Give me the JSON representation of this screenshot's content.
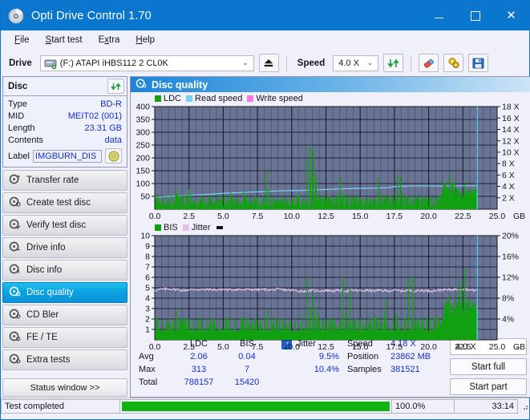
{
  "window": {
    "title": "Opti Drive Control 1.70",
    "icon": "disc-icon",
    "controls": {
      "minimize": "minimize-icon",
      "maximize": "maximize-icon",
      "close": "close-icon"
    }
  },
  "menu": {
    "items": [
      {
        "label": "File",
        "accel": "F"
      },
      {
        "label": "Start test",
        "accel": "S"
      },
      {
        "label": "Extra",
        "accel": "x"
      },
      {
        "label": "Help",
        "accel": "H"
      }
    ]
  },
  "toolbar": {
    "drive_label": "Drive",
    "drive_value": "(F:)  ATAPI iHBS112  2 CL0K",
    "eject_icon": "eject-icon",
    "speed_label": "Speed",
    "speed_value": "4.0 X",
    "refresh_icon": "refresh-icon",
    "erase_icon": "eraser-icon",
    "settings_icon": "gears-icon",
    "save_icon": "save-icon"
  },
  "disc": {
    "title": "Disc",
    "refresh_icon": "refresh-icon",
    "rows": [
      {
        "key": "Type",
        "value": "BD-R"
      },
      {
        "key": "MID",
        "value": "MEIT02 (001)"
      },
      {
        "key": "Length",
        "value": "23.31 GB"
      },
      {
        "key": "Contents",
        "value": "data"
      }
    ],
    "label_key": "Label",
    "label_value": "IMGBURN_DIS",
    "label_icon": "cd-icon"
  },
  "nav": {
    "items": [
      {
        "label": "Transfer rate",
        "icon": "disc-test-icon",
        "active": false
      },
      {
        "label": "Create test disc",
        "icon": "disc-test-icon",
        "active": false
      },
      {
        "label": "Verify test disc",
        "icon": "disc-test-icon",
        "active": false
      },
      {
        "label": "Drive info",
        "icon": "disc-test-icon",
        "active": false
      },
      {
        "label": "Disc info",
        "icon": "disc-test-icon",
        "active": false
      },
      {
        "label": "Disc quality",
        "icon": "disc-test-icon",
        "active": true
      },
      {
        "label": "CD Bler",
        "icon": "disc-test-icon",
        "active": false
      },
      {
        "label": "FE / TE",
        "icon": "disc-test-icon",
        "active": false
      },
      {
        "label": "Extra tests",
        "icon": "disc-test-icon",
        "active": false
      }
    ],
    "status_window": "Status window >>"
  },
  "main": {
    "title": "Disc quality",
    "icon": "disc-quality-icon"
  },
  "colors": {
    "ldc": "#11a111",
    "bis": "#11a111",
    "read_speed": "#79d2f2",
    "write_speed": "#f47ae0",
    "jitter": "#e3c0e8",
    "plot_bg": "#697495",
    "grid": "#151a28",
    "accent": "#1430c8",
    "cursor": "#5ec8f0",
    "progress": "#13b213"
  },
  "chart_data": [
    {
      "type": "line",
      "name": "ldc-chart",
      "title": "",
      "xlabel": "GB",
      "ylabel": "",
      "y2label": "X",
      "xlim": [
        0,
        25.0
      ],
      "ylim": [
        0,
        400
      ],
      "y2lim": [
        0,
        18
      ],
      "grid": true,
      "legend_position": "top-left",
      "legend": [
        {
          "label": "LDC",
          "color": "#11a111"
        },
        {
          "label": "Read speed",
          "color": "#79d2f2"
        },
        {
          "label": "Write speed",
          "color": "#f47ae0"
        }
      ],
      "xticks": [
        "0.0",
        "2.5",
        "5.0",
        "7.5",
        "10.0",
        "12.5",
        "15.0",
        "17.5",
        "20.0",
        "22.5",
        "25.0"
      ],
      "xtick_values": [
        0,
        2.5,
        5,
        7.5,
        10,
        12.5,
        15,
        17.5,
        20,
        22.5,
        25
      ],
      "yticks": [
        "50",
        "100",
        "150",
        "200",
        "250",
        "300",
        "350",
        "400"
      ],
      "ytick_values": [
        50,
        100,
        150,
        200,
        250,
        300,
        350,
        400
      ],
      "y2ticks": [
        "2 X",
        "4 X",
        "6 X",
        "8 X",
        "10 X",
        "12 X",
        "14 X",
        "16 X",
        "18 X"
      ],
      "y2tick_values": [
        2,
        4,
        6,
        8,
        10,
        12,
        14,
        16,
        18
      ],
      "data_end_gb": 23.55,
      "series": [
        {
          "name": "Read speed",
          "color": "#79d2f2",
          "axis": "y2",
          "x": [
            0.0,
            1.0,
            2.0,
            3.0,
            4.0,
            5.0,
            6.0,
            7.0,
            8.0,
            9.0,
            10.0,
            11.0,
            12.0,
            13.0,
            14.0,
            15.0,
            16.0,
            17.0,
            17.6,
            18.5,
            19.5,
            20.5,
            21.5,
            22.5,
            23.5
          ],
          "values": [
            2.1,
            2.25,
            2.35,
            2.5,
            2.6,
            2.8,
            2.9,
            3.0,
            3.1,
            3.2,
            3.25,
            3.3,
            3.4,
            3.5,
            3.6,
            3.65,
            3.7,
            3.75,
            4.0,
            4.05,
            4.1,
            4.05,
            4.05,
            4.1,
            4.1
          ]
        },
        {
          "name": "LDC",
          "color": "#11a111",
          "axis": "y1",
          "note": "dense per-sample spike histogram, baseline ~15-40, many spikes 60-250, rising density after 21 GB",
          "x": [
            0.1,
            0.3,
            0.5,
            0.7,
            0.9,
            1.1,
            1.3,
            1.5,
            1.6,
            1.7,
            1.9,
            2.1,
            2.3,
            2.45,
            2.5,
            2.7,
            2.9,
            3.1,
            3.3,
            3.5,
            3.7,
            3.9,
            4.1,
            4.3,
            4.5,
            4.7,
            4.9,
            5.05,
            5.1,
            5.3,
            5.5,
            5.6,
            5.7,
            5.9,
            6.1,
            6.3,
            6.45,
            6.5,
            6.7,
            6.9,
            7.1,
            7.3,
            7.5,
            7.7,
            7.9,
            8.1,
            8.3,
            8.45,
            8.5,
            8.7,
            8.9,
            9.1,
            9.3,
            9.5,
            9.7,
            9.9,
            10.1,
            10.3,
            10.5,
            10.7,
            10.9,
            11.1,
            11.3,
            11.35,
            11.5,
            11.55,
            11.7,
            11.75,
            11.9,
            12.1,
            12.3,
            12.5,
            12.7,
            12.9,
            13.1,
            13.3,
            13.5,
            13.7,
            13.9,
            14.1,
            14.3,
            14.5,
            14.7,
            14.9,
            15.1,
            15.3,
            15.5,
            15.7,
            15.9,
            16.1,
            16.3,
            16.5,
            16.7,
            16.9,
            17.1,
            17.3,
            17.5,
            17.6,
            17.7,
            17.9,
            18.1,
            18.3,
            18.5,
            18.7,
            18.9,
            19.0,
            19.1,
            19.3,
            19.5,
            19.7,
            19.9,
            20.1,
            20.3,
            20.5,
            20.7,
            20.9,
            21.1,
            21.3,
            21.5,
            21.7,
            21.9,
            22.1,
            22.3,
            22.5,
            22.7,
            22.9,
            23.1,
            23.3,
            23.5
          ],
          "values": [
            20,
            25,
            18,
            22,
            30,
            26,
            24,
            75,
            60,
            40,
            28,
            26,
            30,
            78,
            55,
            24,
            22,
            26,
            30,
            28,
            24,
            22,
            30,
            26,
            24,
            55,
            35,
            42,
            30,
            28,
            70,
            48,
            35,
            30,
            26,
            24,
            70,
            45,
            30,
            28,
            26,
            30,
            28,
            26,
            30,
            150,
            80,
            45,
            30,
            28,
            26,
            30,
            28,
            26,
            30,
            28,
            30,
            26,
            28,
            30,
            26,
            200,
            250,
            120,
            145,
            230,
            135,
            120,
            55,
            40,
            35,
            40,
            38,
            36,
            40,
            38,
            125,
            60,
            40,
            60,
            40,
            35,
            40,
            38,
            36,
            40,
            38,
            40,
            36,
            38,
            125,
            60,
            45,
            35,
            40,
            38,
            36,
            40,
            135,
            125,
            60,
            45,
            40,
            38,
            36,
            40,
            38,
            36,
            40,
            38,
            42,
            44,
            46,
            48,
            52,
            60,
            70,
            90,
            140,
            100,
            70,
            60,
            55,
            50,
            48
          ]
        }
      ],
      "cursor_gb": 23.55
    },
    {
      "type": "line",
      "name": "bis-chart",
      "title": "",
      "xlabel": "GB",
      "ylabel": "",
      "y2label": "%",
      "xlim": [
        0,
        25.0
      ],
      "ylim": [
        0,
        10
      ],
      "y2lim": [
        0,
        20
      ],
      "grid": true,
      "legend_position": "top-left",
      "legend": [
        {
          "label": "BIS",
          "color": "#11a111"
        },
        {
          "label": "Jitter",
          "color": "#e3c0e8"
        }
      ],
      "xticks": [
        "0.0",
        "2.5",
        "5.0",
        "7.5",
        "10.0",
        "12.5",
        "15.0",
        "17.5",
        "20.0",
        "22.5",
        "25.0"
      ],
      "xtick_values": [
        0,
        2.5,
        5,
        7.5,
        10,
        12.5,
        15,
        17.5,
        20,
        22.5,
        25
      ],
      "yticks": [
        "1",
        "2",
        "3",
        "4",
        "5",
        "6",
        "7",
        "8",
        "9",
        "10"
      ],
      "ytick_values": [
        1,
        2,
        3,
        4,
        5,
        6,
        7,
        8,
        9,
        10
      ],
      "y2ticks": [
        "4%",
        "8%",
        "12%",
        "16%",
        "20%"
      ],
      "y2tick_values": [
        4,
        8,
        12,
        16,
        20
      ],
      "data_end_gb": 23.55,
      "series": [
        {
          "name": "Jitter",
          "color": "#e3c0e8",
          "axis": "y2",
          "note": "noisy flat band around 9.4-9.7%",
          "x": [
            0.0,
            0.5,
            1.0,
            1.5,
            2.0,
            2.5,
            3.0,
            3.5,
            4.0,
            4.5,
            5.0,
            5.5,
            6.0,
            6.5,
            7.0,
            7.5,
            8.0,
            8.5,
            9.0,
            9.5,
            10.0,
            10.5,
            11.0,
            11.5,
            12.0,
            12.5,
            13.0,
            13.5,
            14.0,
            14.5,
            15.0,
            15.5,
            16.0,
            16.5,
            17.0,
            17.5,
            18.0,
            18.5,
            19.0,
            19.5,
            20.0,
            20.5,
            21.0,
            21.5,
            22.0,
            22.5,
            23.0,
            23.5
          ],
          "values": [
            9.5,
            9.7,
            9.8,
            9.7,
            9.5,
            9.6,
            9.7,
            9.6,
            9.7,
            9.6,
            9.7,
            9.6,
            9.7,
            9.6,
            9.7,
            9.6,
            9.7,
            9.6,
            9.7,
            9.6,
            9.5,
            9.4,
            9.3,
            9.5,
            9.4,
            9.5,
            9.4,
            9.5,
            9.4,
            9.5,
            9.4,
            9.5,
            9.4,
            9.5,
            9.4,
            9.5,
            9.4,
            9.5,
            9.4,
            9.5,
            9.4,
            9.5,
            9.6,
            9.6,
            9.7,
            9.8,
            9.6,
            9.5
          ]
        },
        {
          "name": "BIS",
          "color": "#11a111",
          "axis": "y1",
          "note": "baseline filled ~0.8, spikes to 2-3 frequently, up to 6-7 near 11.3 and 22.5 GB",
          "x": [
            0.1,
            0.4,
            0.7,
            1.0,
            1.2,
            1.4,
            1.55,
            1.7,
            1.85,
            2.0,
            2.15,
            2.3,
            2.5,
            2.8,
            3.1,
            3.4,
            3.7,
            4.0,
            4.3,
            4.6,
            4.9,
            5.2,
            5.5,
            5.8,
            6.1,
            6.4,
            6.7,
            7.0,
            7.3,
            7.6,
            7.9,
            8.2,
            8.45,
            8.7,
            9.0,
            9.3,
            9.6,
            9.9,
            10.2,
            10.5,
            10.8,
            11.1,
            11.3,
            11.5,
            11.7,
            11.9,
            12.2,
            12.5,
            12.8,
            13.1,
            13.4,
            13.7,
            13.9,
            14.2,
            14.5,
            14.8,
            15.0,
            15.3,
            15.6,
            15.9,
            16.2,
            16.5,
            16.8,
            17.1,
            17.4,
            17.6,
            17.9,
            18.2,
            18.5,
            18.8,
            19.0,
            19.2,
            19.5,
            19.8,
            20.1,
            20.4,
            20.7,
            21.0,
            21.3,
            21.6,
            21.9,
            22.2,
            22.4,
            22.6,
            22.8,
            23.0,
            23.2,
            23.4
          ],
          "values": [
            0.9,
            0.9,
            0.9,
            2.0,
            0.9,
            2.0,
            3.0,
            2.0,
            1.8,
            2.0,
            1.8,
            0.9,
            2.0,
            0.9,
            0.9,
            2.0,
            0.9,
            0.9,
            2.0,
            0.9,
            0.9,
            1.9,
            0.9,
            2.0,
            0.9,
            2.0,
            0.9,
            0.9,
            2.0,
            0.9,
            0.9,
            3.0,
            2.0,
            0.9,
            0.9,
            2.0,
            0.9,
            0.9,
            2.0,
            0.9,
            0.9,
            6.0,
            3.0,
            4.5,
            3.0,
            2.5,
            0.9,
            2.0,
            0.9,
            2.0,
            0.9,
            6.0,
            2.5,
            5.0,
            2.0,
            0.9,
            2.0,
            0.9,
            2.0,
            0.9,
            2.0,
            0.9,
            4.0,
            0.9,
            2.0,
            2.5,
            0.9,
            2.0,
            6.0,
            6.0,
            2.0,
            1.5,
            2.0,
            0.9,
            2.0,
            1.5,
            2.0,
            1.5,
            2.0,
            2.5,
            3.0,
            6.0,
            5.0,
            7.0,
            4.0,
            4.0,
            3.5,
            3.0
          ]
        }
      ],
      "cursor_gb": 23.55
    }
  ],
  "stats": {
    "columns": [
      "LDC",
      "BIS"
    ],
    "rows": [
      {
        "key": "Avg",
        "ldc": "2.06",
        "bis": "0.04",
        "jitter": "9.5%"
      },
      {
        "key": "Max",
        "ldc": "313",
        "bis": "7",
        "jitter": "10.4%"
      },
      {
        "key": "Total",
        "ldc": "788157",
        "bis": "15420",
        "jitter": ""
      }
    ],
    "jitter_label": "Jitter",
    "jitter_checked": true,
    "right": [
      {
        "key": "Speed",
        "value": "4.18 X"
      },
      {
        "key": "Position",
        "value": "23862 MB"
      },
      {
        "key": "Samples",
        "value": "381521"
      }
    ],
    "speed_select": "4.0 X",
    "start_full": "Start full",
    "start_part": "Start part"
  },
  "statusbar": {
    "message": "Test completed",
    "percent_label": "100.0%",
    "percent": 100,
    "time": "33:14"
  }
}
